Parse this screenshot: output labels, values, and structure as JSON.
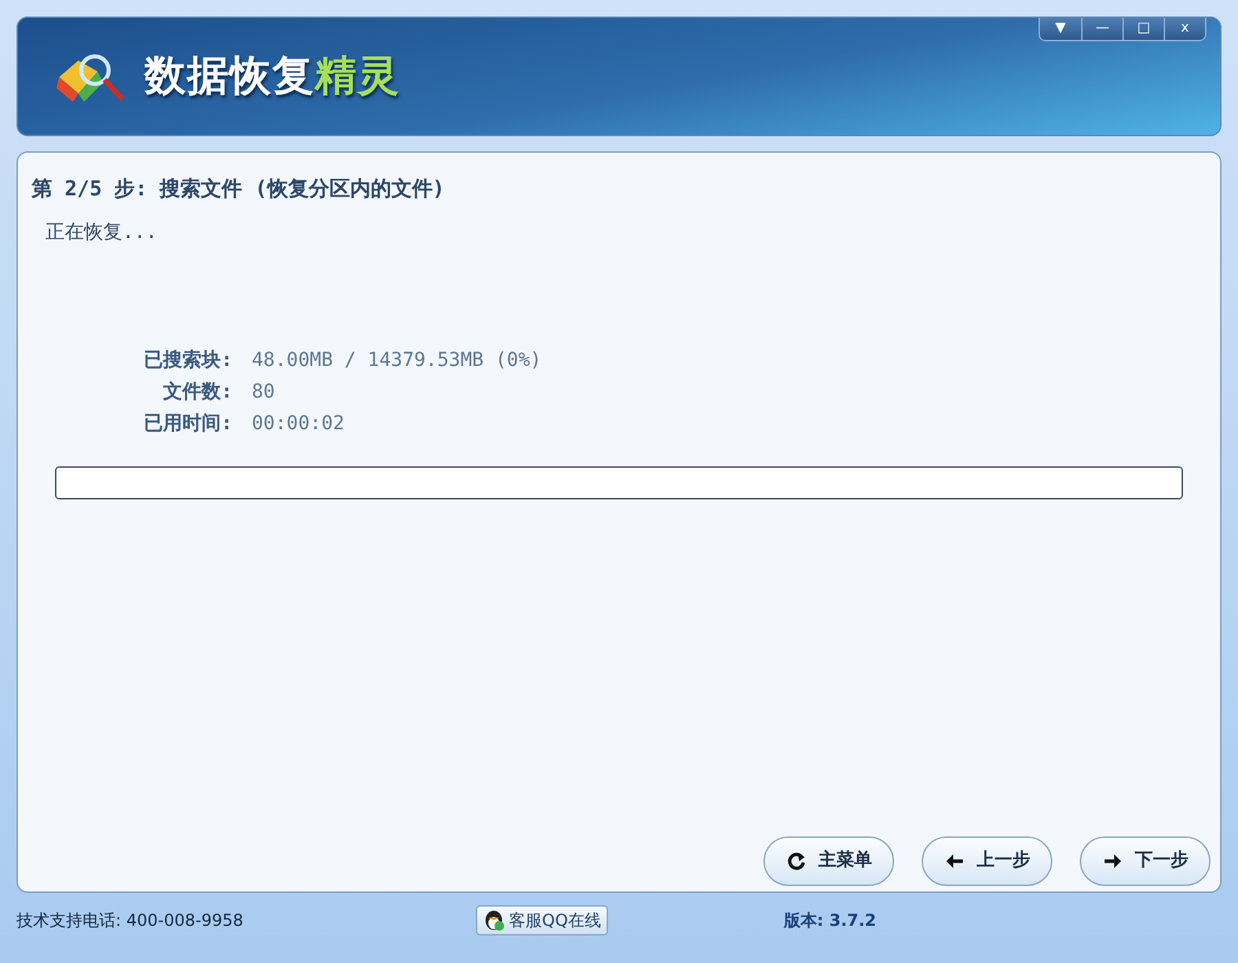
{
  "header": {
    "title_parts": [
      {
        "text": "数据恢复",
        "color": "#ffffff"
      },
      {
        "text": "精灵",
        "color": "#a6e05a"
      }
    ],
    "window_controls": [
      "▼",
      "—",
      "□",
      "x"
    ]
  },
  "step": {
    "title": "第 2/5 步: 搜索文件 (恢复分区内的文件)",
    "status": "正在恢复..."
  },
  "stats": [
    {
      "label": "已搜索块:",
      "value": "48.00MB / 14379.53MB (0%)"
    },
    {
      "label": "文件数:",
      "value": "80"
    },
    {
      "label": "已用时间:",
      "value": "00:00:02"
    }
  ],
  "progress": {
    "level": 0
  },
  "buttons": [
    {
      "kind": "menu",
      "label": "主菜单"
    },
    {
      "kind": "back",
      "label": "上一步"
    },
    {
      "kind": "next",
      "label": "下一步"
    }
  ],
  "footer": {
    "support": "技术支持电话: 400-008-9958",
    "qq_button": "客服QQ在线",
    "version": "版本: 3.7.2"
  }
}
